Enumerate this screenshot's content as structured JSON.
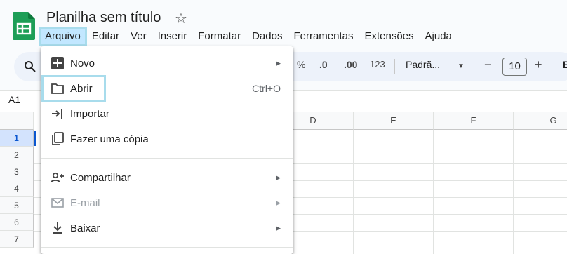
{
  "header": {
    "title": "Planilha sem título"
  },
  "menubar": [
    "Arquivo",
    "Editar",
    "Ver",
    "Inserir",
    "Formatar",
    "Dados",
    "Ferramentas",
    "Extensões",
    "Ajuda"
  ],
  "toolbar": {
    "percent": "%",
    "dec_decrease": ".0",
    "dec_increase": ".00",
    "number_format": "123",
    "font_name": "Padrã...",
    "minus": "−",
    "font_size": "10",
    "plus": "+",
    "bold": "B"
  },
  "formula": {
    "name_box": "A1"
  },
  "columns": [
    "D",
    "E",
    "F",
    "G"
  ],
  "rows": [
    "1",
    "2",
    "3",
    "4",
    "5",
    "6",
    "7"
  ],
  "file_menu": {
    "items": [
      {
        "label": "Novo",
        "icon": "plus-box-icon",
        "has_submenu": true
      },
      {
        "label": "Abrir",
        "icon": "folder-icon",
        "shortcut": "Ctrl+O"
      },
      {
        "label": "Importar",
        "icon": "import-icon"
      },
      {
        "label": "Fazer uma cópia",
        "icon": "copy-icon"
      },
      {
        "label": "Compartilhar",
        "icon": "person-add-icon",
        "has_submenu": true
      },
      {
        "label": "E-mail",
        "icon": "mail-icon",
        "has_submenu": true,
        "disabled": true
      },
      {
        "label": "Baixar",
        "icon": "download-icon",
        "has_submenu": true
      }
    ]
  }
}
